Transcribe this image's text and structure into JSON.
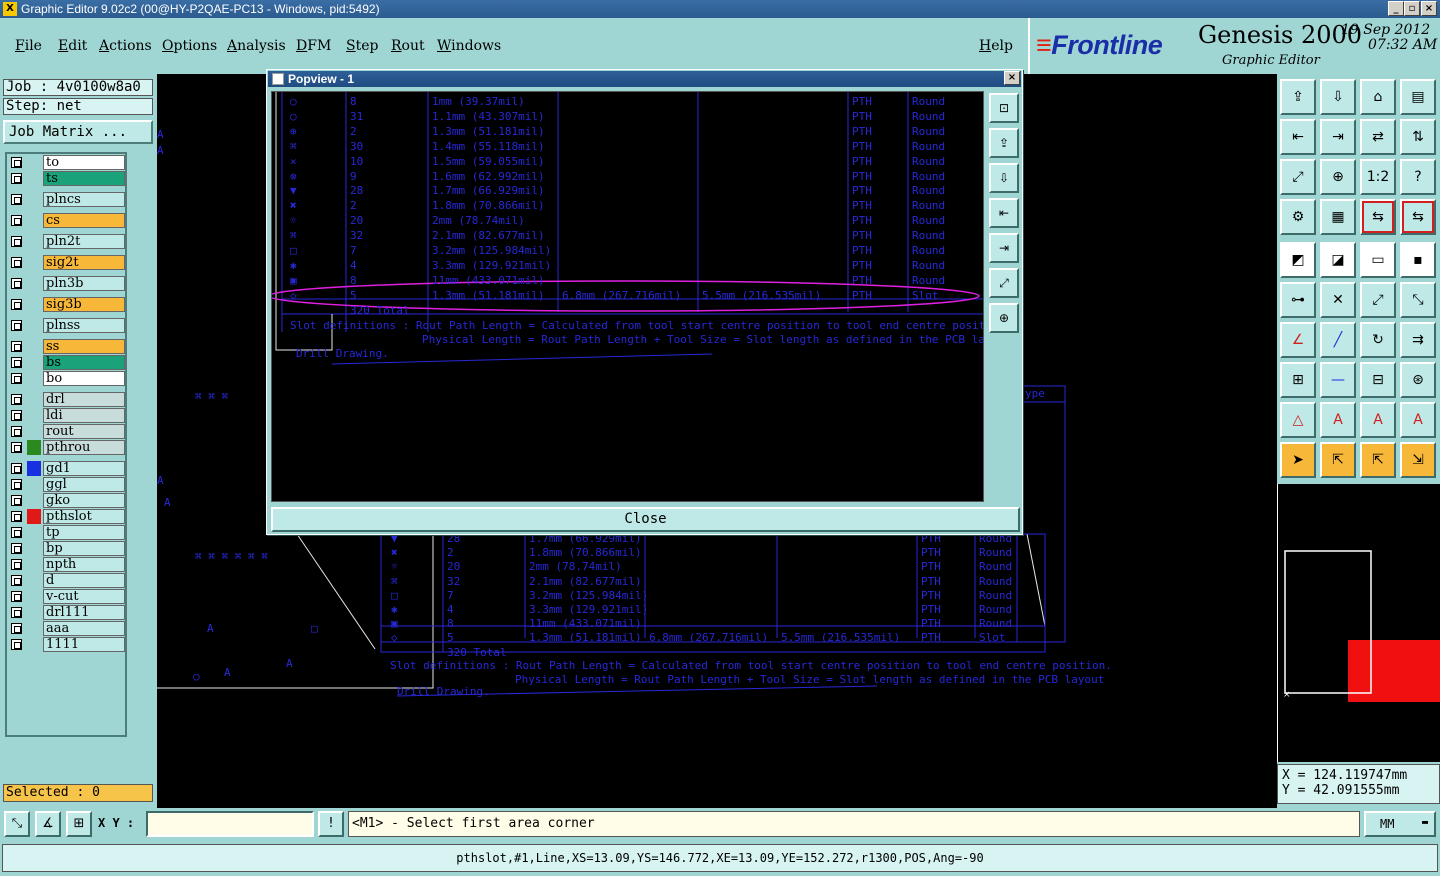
{
  "window": {
    "title": "Graphic Editor 9.02c2 (00@HY-P2QAE-PC13 - Windows, pid:5492)",
    "buttons": [
      "_",
      "▫",
      "×"
    ]
  },
  "menu": [
    "File",
    "Edit",
    "Actions",
    "Options",
    "Analysis",
    "DFM",
    "Step",
    "Rout",
    "Windows"
  ],
  "help": "Help",
  "brand": {
    "logo": "Frontline",
    "product": "Genesis 2000",
    "subtitle": "Graphic Editor",
    "date": "19 Sep 2012",
    "time": "07:32 AM"
  },
  "job": {
    "job_label": "Job : 4v0100w8a0",
    "step_label": "Step: net",
    "matrix_button": "Job Matrix ..."
  },
  "layers": [
    {
      "name": "to",
      "bg": "#ffffff",
      "mark": "✐",
      "swatch": ""
    },
    {
      "name": "ts",
      "bg": "#1aa37a",
      "mark": "✐",
      "swatch": ""
    },
    {
      "name": "plncs",
      "bg": "#bfe9e6",
      "mark": "",
      "swatch": ""
    },
    {
      "name": "cs",
      "bg": "#f7b83a",
      "mark": "✐",
      "swatch": ""
    },
    {
      "name": "pln2t",
      "bg": "#bfe9e6",
      "mark": "",
      "swatch": ""
    },
    {
      "name": "sig2t",
      "bg": "#f7b83a",
      "mark": "",
      "swatch": ""
    },
    {
      "name": "pln3b",
      "bg": "#bfe9e6",
      "mark": "",
      "swatch": ""
    },
    {
      "name": "sig3b",
      "bg": "#f7b83a",
      "mark": "",
      "swatch": ""
    },
    {
      "name": "plnss",
      "bg": "#bfe9e6",
      "mark": "",
      "swatch": ""
    },
    {
      "name": "ss",
      "bg": "#f7b83a",
      "mark": "",
      "swatch": ""
    },
    {
      "name": "bs",
      "bg": "#1aa37a",
      "mark": "✐",
      "swatch": ""
    },
    {
      "name": "bo",
      "bg": "#ffffff",
      "mark": "✐",
      "swatch": ""
    },
    {
      "name": "drl",
      "bg": "#c8dcdc",
      "mark": "",
      "swatch": ""
    },
    {
      "name": "ldi",
      "bg": "#c8dcdc",
      "mark": "",
      "swatch": ""
    },
    {
      "name": "rout",
      "bg": "#c8dcdc",
      "mark": "",
      "swatch": ""
    },
    {
      "name": "pthrou",
      "bg": "#c8dcdc",
      "mark": "",
      "swatch": "#2a8a20"
    },
    {
      "name": "gd1",
      "bg": "#bfe9e6",
      "mark": "✐",
      "swatch": "#1830e0"
    },
    {
      "name": "ggl",
      "bg": "#bfe9e6",
      "mark": "",
      "swatch": ""
    },
    {
      "name": "gko",
      "bg": "#bfe9e6",
      "mark": "",
      "swatch": ""
    },
    {
      "name": "pthslot",
      "bg": "#bfe9e6",
      "mark": "▣",
      "swatch": "#e01818"
    },
    {
      "name": "tp",
      "bg": "#bfe9e6",
      "mark": "",
      "swatch": ""
    },
    {
      "name": "bp",
      "bg": "#bfe9e6",
      "mark": "",
      "swatch": ""
    },
    {
      "name": "npth",
      "bg": "#bfe9e6",
      "mark": "",
      "swatch": ""
    },
    {
      "name": "d",
      "bg": "#bfe9e6",
      "mark": "",
      "swatch": ""
    },
    {
      "name": "v-cut",
      "bg": "#bfe9e6",
      "mark": "",
      "swatch": ""
    },
    {
      "name": "drl111",
      "bg": "#bfe9e6",
      "mark": "",
      "swatch": ""
    },
    {
      "name": "aaa",
      "bg": "#bfe9e6",
      "mark": "",
      "swatch": ""
    },
    {
      "name": "1111",
      "bg": "#bfe9e6",
      "mark": "",
      "swatch": ""
    }
  ],
  "selected": "Selected : 0",
  "popup": {
    "title": "Popview - 1",
    "close_label": "Close",
    "rows": [
      {
        "sym": "○",
        "count": "8",
        "size": "1mm (39.37mil)",
        "len": "",
        "phys": "",
        "type": "PTH",
        "shape": "Round"
      },
      {
        "sym": "○",
        "count": "31",
        "size": "1.1mm (43.307mil)",
        "len": "",
        "phys": "",
        "type": "PTH",
        "shape": "Round"
      },
      {
        "sym": "⊕",
        "count": "2",
        "size": "1.3mm (51.181mil)",
        "len": "",
        "phys": "",
        "type": "PTH",
        "shape": "Round"
      },
      {
        "sym": "⌘",
        "count": "30",
        "size": "1.4mm (55.118mil)",
        "len": "",
        "phys": "",
        "type": "PTH",
        "shape": "Round"
      },
      {
        "sym": "×",
        "count": "10",
        "size": "1.5mm (59.055mil)",
        "len": "",
        "phys": "",
        "type": "PTH",
        "shape": "Round"
      },
      {
        "sym": "⊗",
        "count": "9",
        "size": "1.6mm (62.992mil)",
        "len": "",
        "phys": "",
        "type": "PTH",
        "shape": "Round"
      },
      {
        "sym": "▼",
        "count": "28",
        "size": "1.7mm (66.929mil)",
        "len": "",
        "phys": "",
        "type": "PTH",
        "shape": "Round"
      },
      {
        "sym": "✖",
        "count": "2",
        "size": "1.8mm (70.866mil)",
        "len": "",
        "phys": "",
        "type": "PTH",
        "shape": "Round"
      },
      {
        "sym": "☼",
        "count": "20",
        "size": "2mm (78.74mil)",
        "len": "",
        "phys": "",
        "type": "PTH",
        "shape": "Round"
      },
      {
        "sym": "⌘",
        "count": "32",
        "size": "2.1mm (82.677mil)",
        "len": "",
        "phys": "",
        "type": "PTH",
        "shape": "Round"
      },
      {
        "sym": "□",
        "count": "7",
        "size": "3.2mm (125.984mil)",
        "len": "",
        "phys": "",
        "type": "PTH",
        "shape": "Round"
      },
      {
        "sym": "✱",
        "count": "4",
        "size": "3.3mm (129.921mil)",
        "len": "",
        "phys": "",
        "type": "PTH",
        "shape": "Round"
      },
      {
        "sym": "▣",
        "count": "8",
        "size": "11mm (433.071mil)",
        "len": "",
        "phys": "",
        "type": "PTH",
        "shape": "Round"
      },
      {
        "sym": "◇",
        "count": "5",
        "size": "1.3mm (51.181mil)",
        "len": "6.8mm (267.716mil)",
        "phys": "5.5mm (216.535mil)",
        "type": "PTH",
        "shape": "Slot"
      },
      {
        "sym": "",
        "count": "320 Total",
        "size": "",
        "len": "",
        "phys": "",
        "type": "",
        "shape": ""
      }
    ],
    "note1": "Slot definitions : Rout Path Length = Calculated from tool start centre position to tool end centre position.",
    "note2": "Physical Length  = Rout Path Length + Tool Size = Slot length as defined in the PCB layout",
    "note3": "Drill Drawing."
  },
  "canvas": {
    "header_fragment": "ype",
    "rows": [
      {
        "sym": "▼",
        "count": "28",
        "size": "1.7mm (66.929mil)",
        "len": "",
        "phys": "",
        "type": "PTH",
        "shape": "Round"
      },
      {
        "sym": "✖",
        "count": "2",
        "size": "1.8mm (70.866mil)",
        "len": "",
        "phys": "",
        "type": "PTH",
        "shape": "Round"
      },
      {
        "sym": "☼",
        "count": "20",
        "size": "2mm (78.74mil)",
        "len": "",
        "phys": "",
        "type": "PTH",
        "shape": "Round"
      },
      {
        "sym": "⌘",
        "count": "32",
        "size": "2.1mm (82.677mil)",
        "len": "",
        "phys": "",
        "type": "PTH",
        "shape": "Round"
      },
      {
        "sym": "□",
        "count": "7",
        "size": "3.2mm (125.984mil)",
        "len": "",
        "phys": "",
        "type": "PTH",
        "shape": "Round"
      },
      {
        "sym": "✱",
        "count": "4",
        "size": "3.3mm (129.921mil)",
        "len": "",
        "phys": "",
        "type": "PTH",
        "shape": "Round"
      },
      {
        "sym": "▣",
        "count": "8",
        "size": "11mm (433.071mil)",
        "len": "",
        "phys": "",
        "type": "PTH",
        "shape": "Round"
      },
      {
        "sym": "◇",
        "count": "5",
        "size": "1.3mm (51.181mil)",
        "len": "6.8mm (267.716mil)",
        "phys": "5.5mm (216.535mil)",
        "type": "PTH",
        "shape": "Slot"
      },
      {
        "sym": "",
        "count": "320 Total",
        "size": "",
        "len": "",
        "phys": "",
        "type": "",
        "shape": ""
      }
    ]
  },
  "tools": [
    "⇪",
    "⇩",
    "⌂",
    "▤",
    "⇤",
    "⇥",
    "⇄",
    "⇅",
    "⤢",
    "⊕",
    "1:2",
    "?",
    "⚙",
    "▦",
    "⇆",
    "⇆",
    "◩",
    "◪",
    "▭",
    "▪",
    "⊶",
    "✕",
    "⤢",
    "⤡",
    "∠",
    "╱",
    "↻",
    "⇉",
    "⊞",
    "—",
    "⊟",
    "⊛",
    "△",
    "A",
    "A",
    "A",
    "➤",
    "⇱",
    "⇱",
    "⇲"
  ],
  "coords": {
    "x": "X = 124.119747mm",
    "y": "Y = 42.091555mm"
  },
  "cmd": {
    "xy_label": "X Y :",
    "xy_value": "",
    "prompt": "<M1> - Select first area corner",
    "units": "MM",
    "status": "pthslot,#1,Line,XS=13.09,YS=146.772,XE=13.09,YE=152.272,r1300,POS,Ang=-90"
  }
}
